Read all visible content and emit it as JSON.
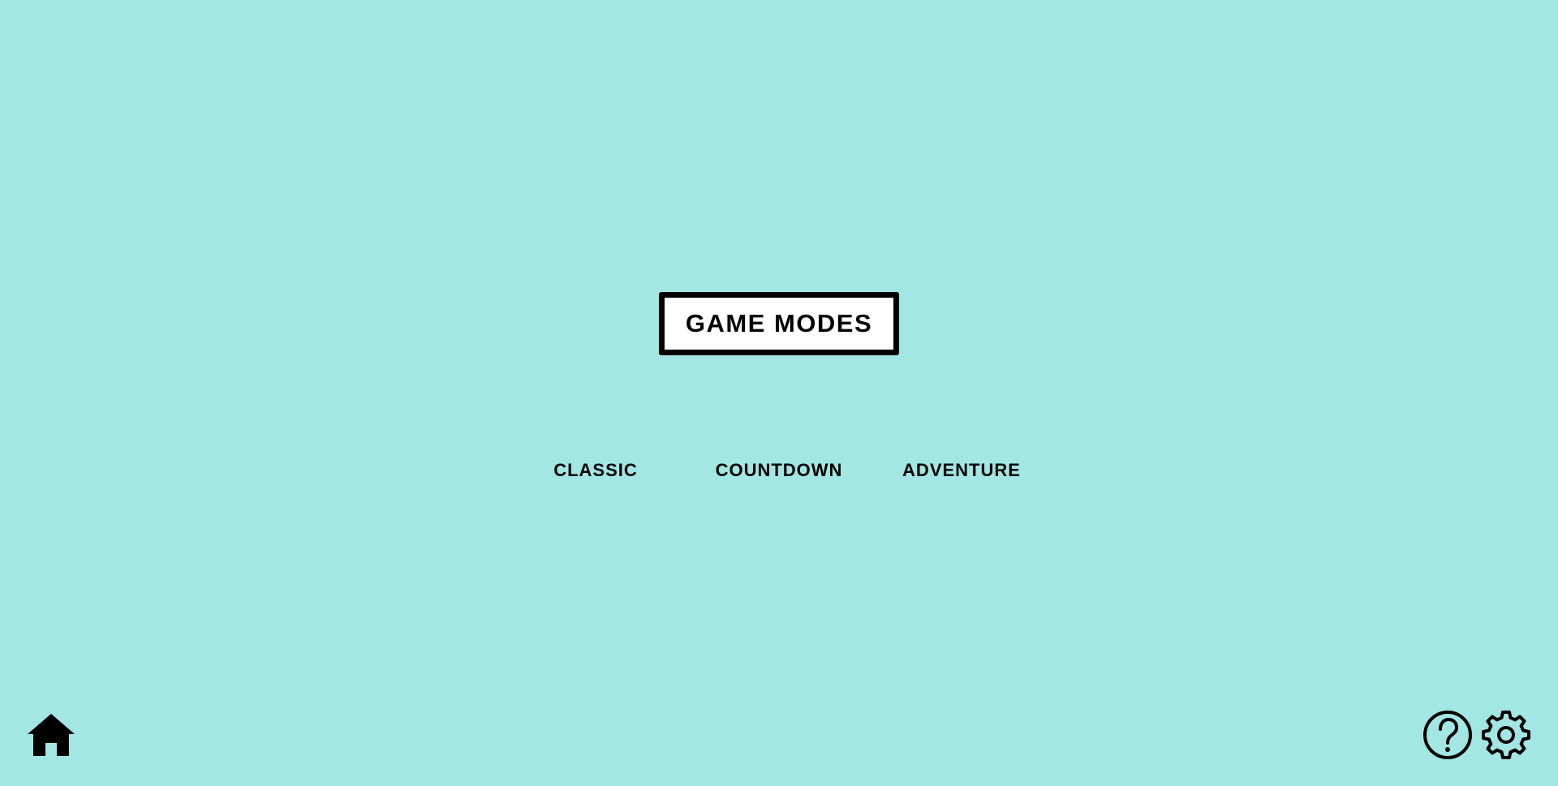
{
  "header": {
    "title": "GAME MODES"
  },
  "modes": [
    {
      "label": "CLASSIC"
    },
    {
      "label": "COUNTDOWN"
    },
    {
      "label": "ADVENTURE"
    }
  ],
  "footer": {
    "home_icon": "home-icon",
    "help_icon": "help-icon",
    "settings_icon": "gear-icon"
  },
  "colors": {
    "background": "#a2e7e4",
    "title_box": "#ffffff",
    "ink": "#000000"
  }
}
